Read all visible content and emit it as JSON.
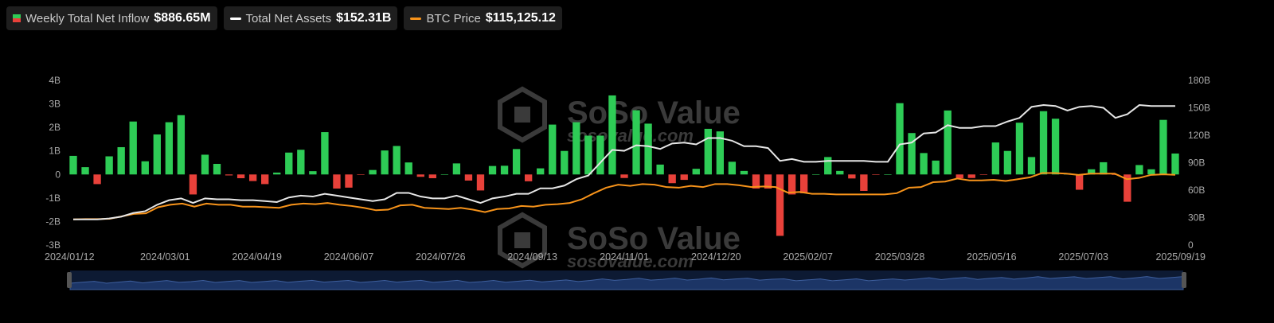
{
  "legend": {
    "inflow_label": "Weekly Total Net Inflow",
    "inflow_value": "$886.65M",
    "assets_label": "Total Net Assets",
    "assets_value": "$152.31B",
    "btc_label": "BTC Price",
    "btc_value": "$115,125.12"
  },
  "watermark": {
    "brand": "SoSo Value",
    "url": "sosovalue.com"
  },
  "colors": {
    "positive": "#2ecc56",
    "negative": "#e8413a",
    "assets_line": "#e6e6e6",
    "btc_line": "#f7931a",
    "navigator": "#1c3566"
  },
  "chart_data": {
    "type": "bar",
    "left_axis": {
      "ticks": [
        "4B",
        "3B",
        "2B",
        "1B",
        "0",
        "-1B",
        "-2B",
        "-3B"
      ],
      "ylim": [
        -3,
        4
      ],
      "unit": "B"
    },
    "right_axis": {
      "ticks": [
        "180B",
        "150B",
        "120B",
        "90B",
        "60B",
        "30B",
        "0"
      ],
      "ylim": [
        0,
        180
      ],
      "unit": "B"
    },
    "x_tick_labels": [
      "2024/01/12",
      "2024/03/01",
      "2024/04/19",
      "2024/06/07",
      "2024/07/26",
      "2024/09/13",
      "2024/11/01",
      "2024/12/20",
      "2025/02/07",
      "2025/03/28",
      "2025/05/16",
      "2025/07/03",
      "2025/09/19"
    ],
    "start_week": "2024/01/12",
    "end_week": "2025/09/19",
    "series": [
      {
        "name": "Weekly Total Net Inflow",
        "values": [
          0.79,
          0.31,
          -0.41,
          0.77,
          1.16,
          2.25,
          0.56,
          1.7,
          2.22,
          2.52,
          -0.85,
          0.84,
          0.45,
          -0.04,
          -0.16,
          -0.28,
          -0.41,
          0.08,
          0.93,
          1.05,
          0.14,
          1.8,
          -0.6,
          -0.56,
          -0.02,
          0.19,
          1.02,
          1.21,
          0.51,
          -0.1,
          -0.16,
          0.01,
          0.47,
          -0.26,
          -0.68,
          0.36,
          0.37,
          1.08,
          -0.29,
          0.26,
          2.12,
          1.0,
          2.22,
          1.65,
          1.65,
          3.36,
          -0.15,
          2.73,
          2.16,
          0.42,
          -0.37,
          -0.23,
          0.24,
          1.94,
          1.83,
          0.54,
          0.15,
          -0.6,
          -0.6,
          -2.61,
          -0.85,
          -0.8,
          0.01,
          0.74,
          0.15,
          -0.17,
          -0.7,
          -0.01,
          0.0,
          3.03,
          1.76,
          0.91,
          0.59,
          2.72,
          -0.16,
          -0.15,
          -0.02,
          1.36,
          1.0,
          2.2,
          0.74,
          2.69,
          2.37,
          0.05,
          -0.65,
          0.22,
          0.52,
          -0.01,
          -1.16,
          0.4,
          0.22,
          2.32,
          0.89
        ]
      },
      {
        "name": "Total Net Assets",
        "values": [
          28,
          28,
          28,
          29,
          31,
          35,
          37,
          44,
          49,
          51,
          46,
          51,
          50,
          50,
          49,
          49,
          48,
          47,
          52,
          54,
          53,
          56,
          54,
          52,
          50,
          48,
          50,
          57,
          57,
          53,
          51,
          51,
          54,
          50,
          46,
          51,
          53,
          56,
          56,
          62,
          62,
          65,
          72,
          76,
          90,
          104,
          103,
          109,
          108,
          105,
          111,
          112,
          110,
          117,
          117,
          114,
          108,
          108,
          106,
          92,
          94,
          91,
          91,
          92,
          92,
          92,
          92,
          91,
          91,
          110,
          112,
          122,
          123,
          131,
          128,
          128,
          130,
          130,
          135,
          139,
          151,
          153,
          152,
          147,
          151,
          152,
          150,
          139,
          143,
          153,
          152,
          152,
          152
        ]
      },
      {
        "name": "BTC Price",
        "values": [
          42000,
          42500,
          42500,
          43000,
          47000,
          51000,
          52000,
          62000,
          66000,
          68000,
          63000,
          68000,
          66000,
          66000,
          63000,
          63000,
          62000,
          61000,
          66000,
          68000,
          67000,
          69000,
          66000,
          64000,
          61000,
          57000,
          58000,
          65000,
          66000,
          61000,
          60000,
          59000,
          61000,
          58000,
          54000,
          59000,
          60000,
          64000,
          63000,
          66000,
          67000,
          69000,
          75000,
          85000,
          94000,
          99000,
          97000,
          100000,
          99000,
          95000,
          94000,
          97000,
          95000,
          100000,
          100000,
          98000,
          95000,
          96000,
          95000,
          86000,
          87000,
          84000,
          84000,
          83000,
          83000,
          83000,
          83000,
          83000,
          85000,
          94000,
          95000,
          103000,
          104000,
          109000,
          106000,
          106000,
          107000,
          105000,
          108000,
          111000,
          118000,
          118000,
          117000,
          115000,
          117000,
          117000,
          117000,
          108000,
          110000,
          115000,
          116000,
          115125
        ]
      }
    ],
    "grid": false,
    "legend_position": "top-left"
  }
}
